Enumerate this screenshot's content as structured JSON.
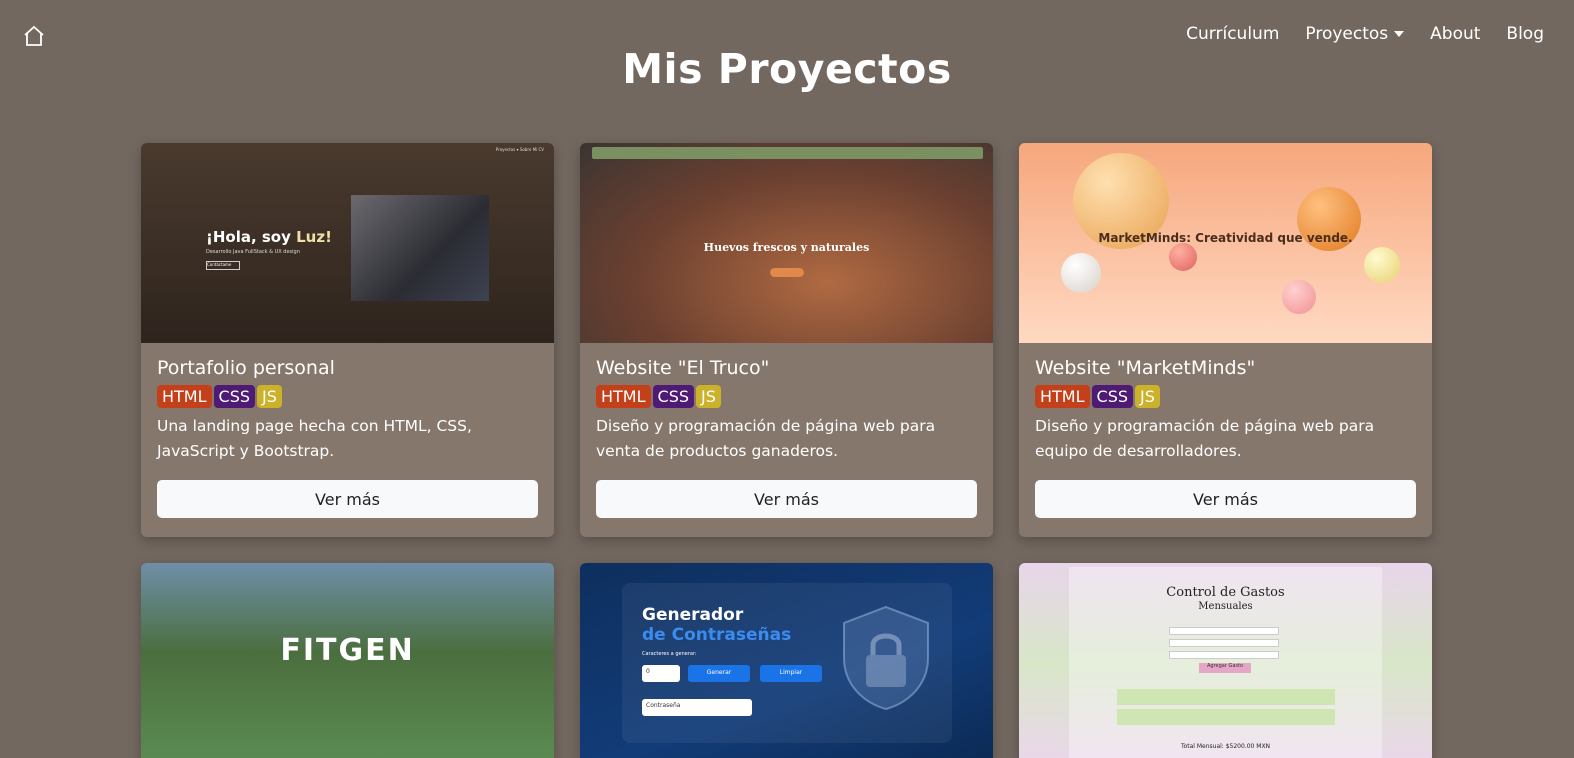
{
  "header": {
    "home_icon": "home-icon",
    "nav": [
      {
        "label": "Currículum"
      },
      {
        "label": "Proyectos",
        "dropdown": true
      },
      {
        "label": "About"
      },
      {
        "label": "Blog"
      }
    ]
  },
  "page": {
    "title": "Mis Proyectos"
  },
  "projects": [
    {
      "title": "Portafolio personal",
      "tags": [
        "HTML",
        "CSS",
        "JS"
      ],
      "description": "Una landing page hecha con HTML, CSS, JavaScript y Bootstrap.",
      "button": "Ver más",
      "thumb": {
        "heading_a": "¡Hola, soy ",
        "heading_b": "Luz!",
        "sub": "Desarrollo Java FullStack & UX design",
        "cta": "Contáctame",
        "nav": "Proyectos ▾   Sobre Mí   CV"
      }
    },
    {
      "title": "Website \"El Truco\"",
      "tags": [
        "HTML",
        "CSS",
        "JS"
      ],
      "description": "Diseño y programación de página web para venta de productos ganaderos.",
      "button": "Ver más",
      "thumb": {
        "heading": "Huevos frescos y naturales"
      }
    },
    {
      "title": "Website \"MarketMinds\"",
      "tags": [
        "HTML",
        "CSS",
        "JS"
      ],
      "description": "Diseño y programación de página web para equipo de desarrolladores.",
      "button": "Ver más",
      "thumb": {
        "heading": "MarketMinds: Creatividad que vende."
      }
    },
    {
      "thumb": {
        "heading": "FITGEN"
      }
    },
    {
      "thumb": {
        "line1": "Generador",
        "line2": "de Contraseñas",
        "label": "Caracteres a generar:",
        "count": "0",
        "generate": "Generar",
        "clear": "Limpiar",
        "password": "Contraseña"
      }
    },
    {
      "thumb": {
        "title": "Control de Gastos",
        "subtitle": "Mensuales",
        "add": "Agregar Gasto",
        "total": "Total Mensual: $5200.00 MXN"
      }
    }
  ],
  "colors": {
    "background": "#736860",
    "card": "#86776c",
    "html_tag": "#c3401b",
    "css_tag": "#4e1a73",
    "js_tag": "#cbb22a"
  }
}
